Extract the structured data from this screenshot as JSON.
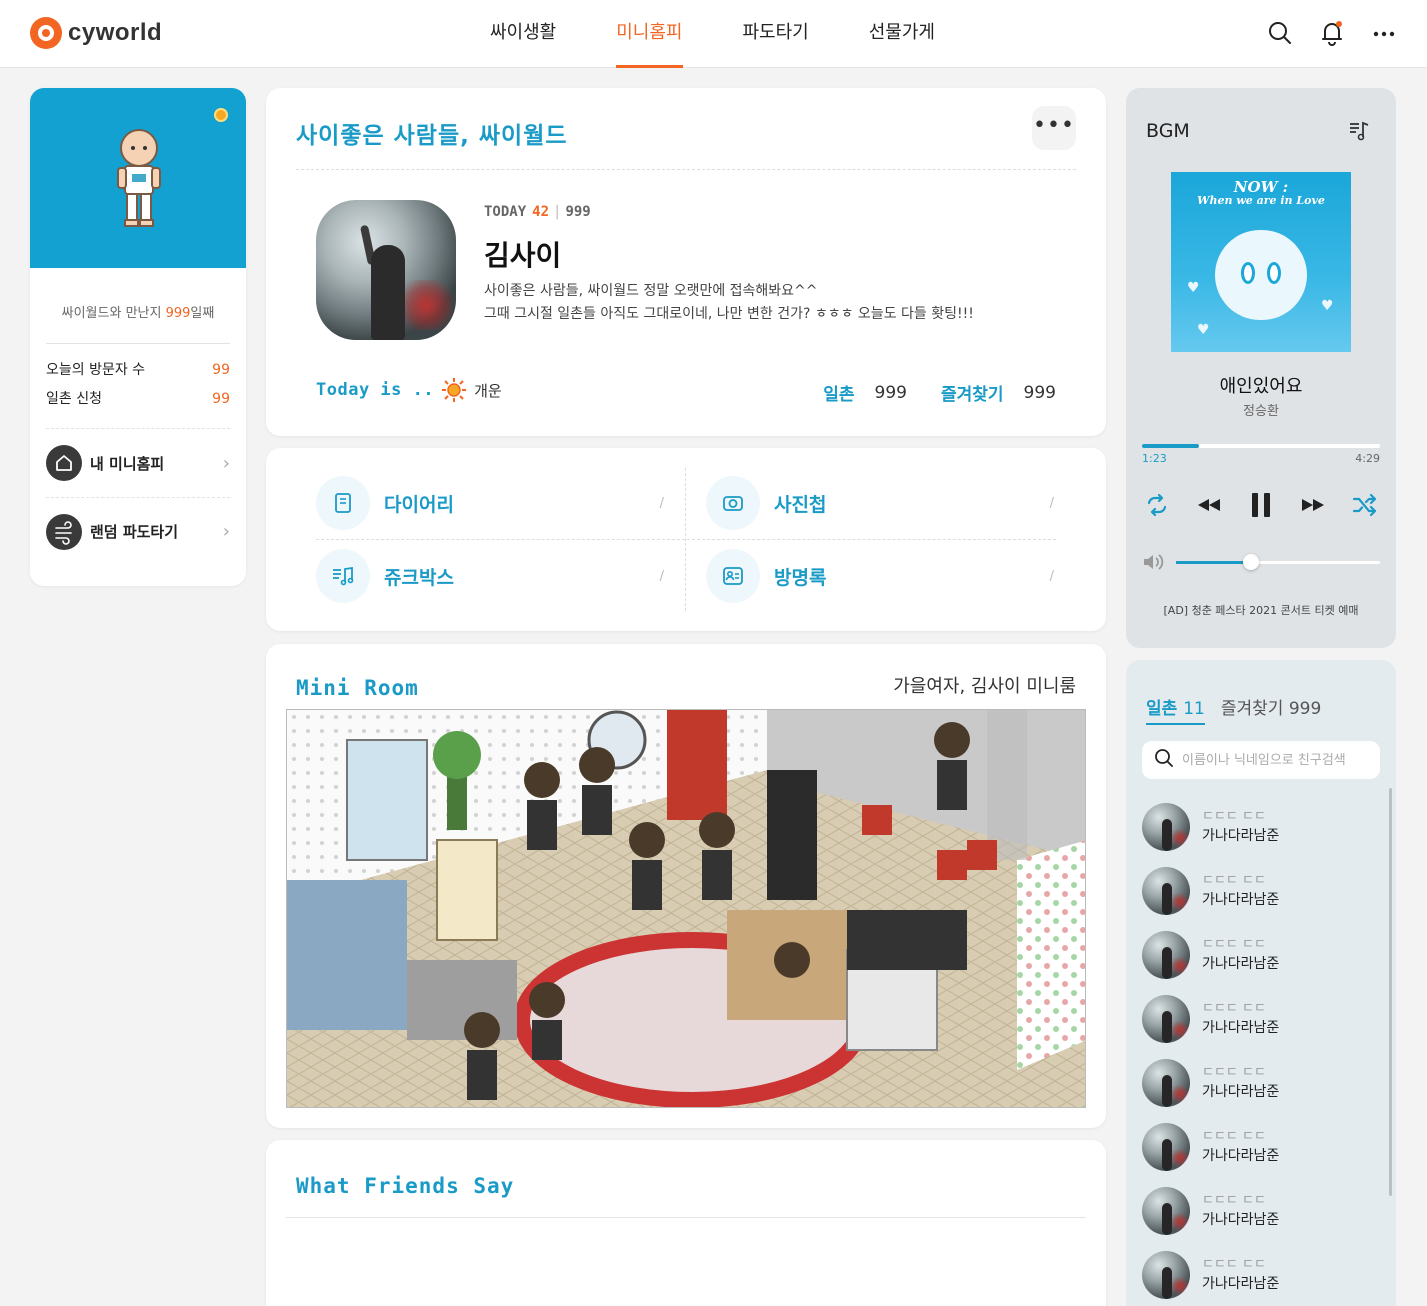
{
  "header": {
    "logo_text": "cyworld",
    "nav": [
      {
        "label": "싸이생활",
        "active": false
      },
      {
        "label": "미니홈피",
        "active": true
      },
      {
        "label": "파도타기",
        "active": false
      },
      {
        "label": "선물가게",
        "active": false
      }
    ],
    "icons": [
      "search-icon",
      "bell-icon",
      "more-icon"
    ],
    "accent_color": "#f26522"
  },
  "left": {
    "days_prefix": "싸이월드와 만난지 ",
    "days_value": "999",
    "days_suffix": "일째",
    "stats": [
      {
        "label": "오늘의 방문자 수",
        "value": "99"
      },
      {
        "label": "일촌 신청",
        "value": "99"
      }
    ],
    "links": [
      {
        "label": "내 미니홈피",
        "icon": "home-icon"
      },
      {
        "label": "랜덤 파도타기",
        "icon": "wave-icon"
      }
    ],
    "top_color": "#12a1d1"
  },
  "profile": {
    "title": "사이좋은 사람들, 싸이월드",
    "more": "•••",
    "today_label": "TODAY",
    "today_count": "42",
    "total_count": "999",
    "name": "김사이",
    "desc1": "사이좋은 사람들, 싸이월드 정말 오랫만에 접속해봐요^^",
    "desc2": "그때 그시절 일촌들 아직도 그대로이네, 나만 변한 건가? ㅎㅎㅎ 오늘도 다들 홧팅!!!",
    "mood_label": "Today is ..",
    "mood_value": "개운",
    "ilchon_label": "일촌",
    "ilchon_value": "999",
    "fav_label": "즐겨찾기",
    "fav_value": "999"
  },
  "menu": [
    {
      "label": "다이어리",
      "icon": "diary-icon",
      "slash": "/"
    },
    {
      "label": "사진첩",
      "icon": "camera-icon",
      "slash": "/"
    },
    {
      "label": "쥬크박스",
      "icon": "music-icon",
      "slash": "/"
    },
    {
      "label": "방명록",
      "icon": "guestbook-icon",
      "slash": "/"
    }
  ],
  "miniroom": {
    "title": "Mini Room",
    "subtitle": "가을여자, 김사이 미니룸"
  },
  "friends_say": {
    "title": "What Friends Say"
  },
  "bgm": {
    "title": "BGM",
    "album_title1": "NOW :",
    "album_title2": "When we are in Love",
    "song": "애인있어요",
    "artist": "정승환",
    "time_current": "1:23",
    "time_total": "4:29",
    "progress": 0.24,
    "volume": 0.37,
    "ad": "[AD] 청춘 페스타 2021 콘서트 티켓 예매"
  },
  "friendlist": {
    "tab_ilchon": "일촌",
    "tab_ilchon_count": "11",
    "tab_fav": "즐겨찾기",
    "tab_fav_count": "999",
    "search_placeholder": "이름이나 닉네임으로 친구검색",
    "items": [
      {
        "status": "ㄷㄷㄷ ㄷㄷ",
        "name": "가나다라남준"
      },
      {
        "status": "ㄷㄷㄷ ㄷㄷ",
        "name": "가나다라남준"
      },
      {
        "status": "ㄷㄷㄷ ㄷㄷ",
        "name": "가나다라남준"
      },
      {
        "status": "ㄷㄷㄷ ㄷㄷ",
        "name": "가나다라남준"
      },
      {
        "status": "ㄷㄷㄷ ㄷㄷ",
        "name": "가나다라남준"
      },
      {
        "status": "ㄷㄷㄷ ㄷㄷ",
        "name": "가나다라남준"
      },
      {
        "status": "ㄷㄷㄷ ㄷㄷ",
        "name": "가나다라남준"
      },
      {
        "status": "ㄷㄷㄷ ㄷㄷ",
        "name": "가나다라남준"
      }
    ]
  }
}
